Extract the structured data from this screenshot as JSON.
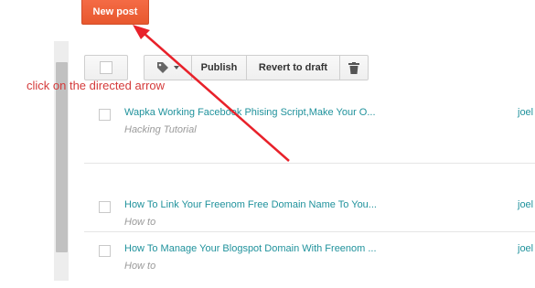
{
  "toolbar": {
    "new_post_label": "New post",
    "publish_label": "Publish",
    "revert_label": "Revert to draft"
  },
  "annotation": {
    "text": "click on the directed arrow",
    "color": "#d43a3a"
  },
  "posts": [
    {
      "title": "Wapka Working Facebook Phising Script,Make Your O...",
      "label": "Hacking Tutorial",
      "author": "joel"
    },
    {
      "title": "How To Link Your Freenom Free Domain Name To You...",
      "label": "How to",
      "author": "joel"
    },
    {
      "title": "How To Manage Your Blogspot Domain With Freenom ...",
      "label": "How to",
      "author": "joel"
    }
  ],
  "icons": [
    "label-tag-icon",
    "trash-icon",
    "arrow-icon"
  ],
  "colors": {
    "accent": "#f26232",
    "link": "#20929c",
    "annotation": "#d43a3a"
  }
}
